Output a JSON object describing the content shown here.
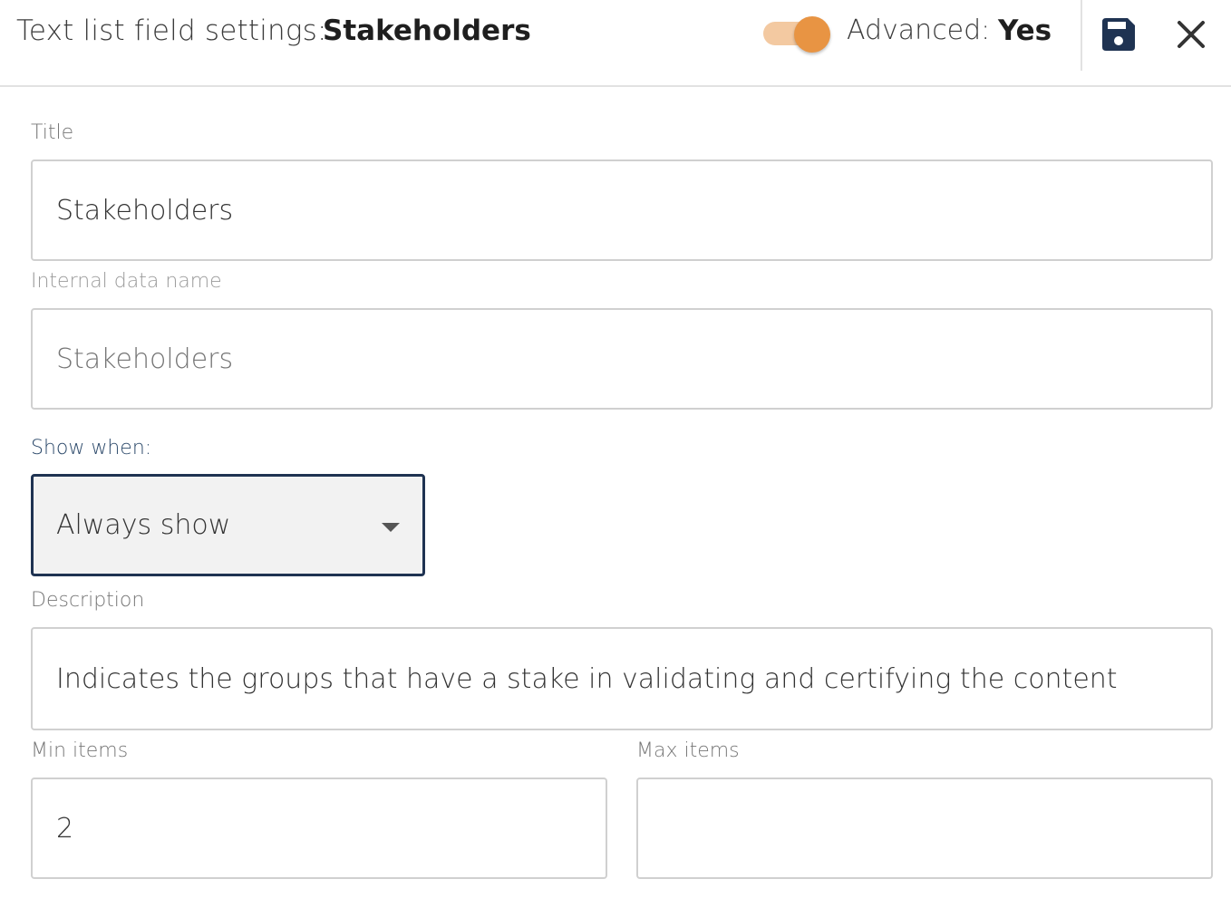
{
  "header": {
    "title_label": "Text list field settings:",
    "title_value": "Stakeholders",
    "advanced_label": "Advanced:",
    "advanced_value": "Yes",
    "advanced_enabled": true,
    "icons": [
      "save-icon",
      "close-icon"
    ]
  },
  "colors": {
    "accent": "#e89443",
    "accent_track": "#f3c9a1",
    "navy": "#1f3352"
  },
  "form": {
    "title": {
      "label": "Title",
      "value": "Stakeholders"
    },
    "internal_name": {
      "label": "Internal data name",
      "placeholder": "Stakeholders"
    },
    "show_when": {
      "label": "Show when:",
      "selected": "Always show"
    },
    "description": {
      "label": "Description",
      "value": "Indicates the groups that have a stake in validating and certifying the content"
    },
    "min_items": {
      "label": "Min items",
      "value": "2"
    },
    "max_items": {
      "label": "Max items",
      "value": ""
    }
  }
}
